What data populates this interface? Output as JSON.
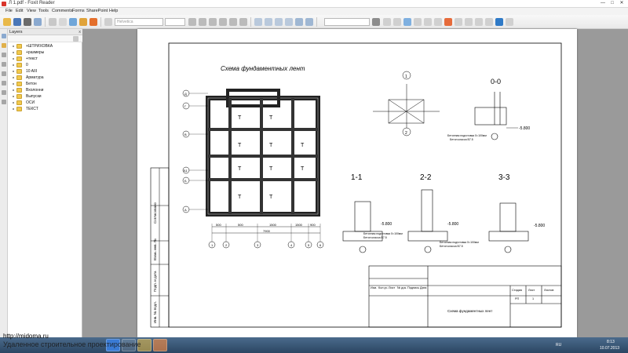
{
  "window": {
    "title": "Л 1.pdf - Foxit Reader",
    "minimize": "—",
    "maximize": "□",
    "close": "✕"
  },
  "menu": [
    "File",
    "Edit",
    "View",
    "Tools",
    "Comments",
    "Forms",
    "SharePoint",
    "Help"
  ],
  "toolbar": {
    "font_field": "Helvetica",
    "search_field": ""
  },
  "layers": {
    "header": "Layers",
    "close": "x",
    "items": [
      "+ШТРИХОВКА",
      "+размеры",
      "+текст",
      "0",
      "10 AIII",
      "Арматура",
      "Бетон",
      "Вхолонни",
      "Выпуски",
      "ОСИ",
      "ТЕКСТ"
    ]
  },
  "drawing": {
    "plan_title": "Схема фундаментных лент",
    "section_00": "0-0",
    "section_11": "1-1",
    "section_22": "2-2",
    "section_33": "3-3",
    "axis_letters": [
      "Д",
      "Г",
      "В",
      "Б1",
      "Б",
      "А"
    ],
    "axis_numbers": [
      "1",
      "2",
      "3",
      "4",
      "5",
      "6"
    ],
    "dims_bottom": [
      "500",
      "500",
      "1500",
      "1500",
      "900",
      "500"
    ],
    "dim_total": "7900",
    "level": "-5.800",
    "note_concrete": "Бетон класса В7.5",
    "note_bedding": "Бетонная подготовка δ=100мм",
    "side_stamp_labels": [
      "Взам. инв. №",
      "Подп. и дата",
      "Инв. № подл.",
      "Согласовано"
    ],
    "title_block_cols": [
      "Изм.",
      "Кол.уч.",
      "Лист",
      "№ док.",
      "Подпись",
      "Дата"
    ],
    "title_block_stage": "Стадия",
    "title_block_sheet": "Лист",
    "title_block_sheets": "Листов",
    "title_block_stage_value": "РП",
    "title_block_sheet_value": "1",
    "title_block_name": "Схема фундаментных лент",
    "section_label_1": "1",
    "section_label_2": "2"
  },
  "watermark": "http://midoma.ru",
  "watermark_sub": "Удаленное строительное проектирование",
  "tray": {
    "lang": "RU",
    "time": "8:13",
    "date": "10.07.2013"
  }
}
